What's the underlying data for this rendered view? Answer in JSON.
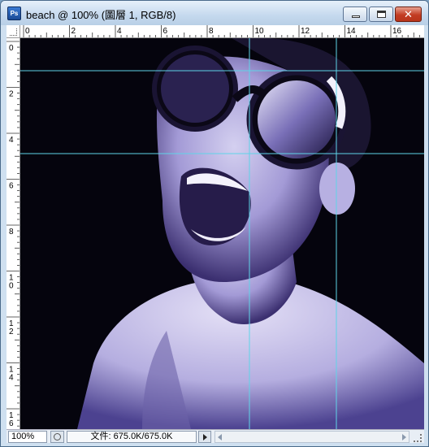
{
  "window": {
    "title": "beach @ 100% (圖層 1, RGB/8)",
    "app_icon_label": "Ps",
    "controls": {
      "minimize": "minimize-icon",
      "maximize": "maximize-icon",
      "close": "close-icon",
      "close_glyph": "✕"
    }
  },
  "rulers": {
    "horizontal_labels": [
      "0",
      "2",
      "4",
      "6",
      "8",
      "10",
      "12",
      "14",
      "16"
    ],
    "vertical_labels": [
      "0",
      "2",
      "4",
      "6",
      "8",
      "10",
      "12",
      "14",
      "16"
    ]
  },
  "status": {
    "zoom": "100%",
    "doc_size": "文件: 675.0K/675.0K"
  },
  "colors": {
    "guide": "#5fd4e8",
    "canvas_background": "#05040d",
    "photo_tint": "#b8b0e8"
  }
}
